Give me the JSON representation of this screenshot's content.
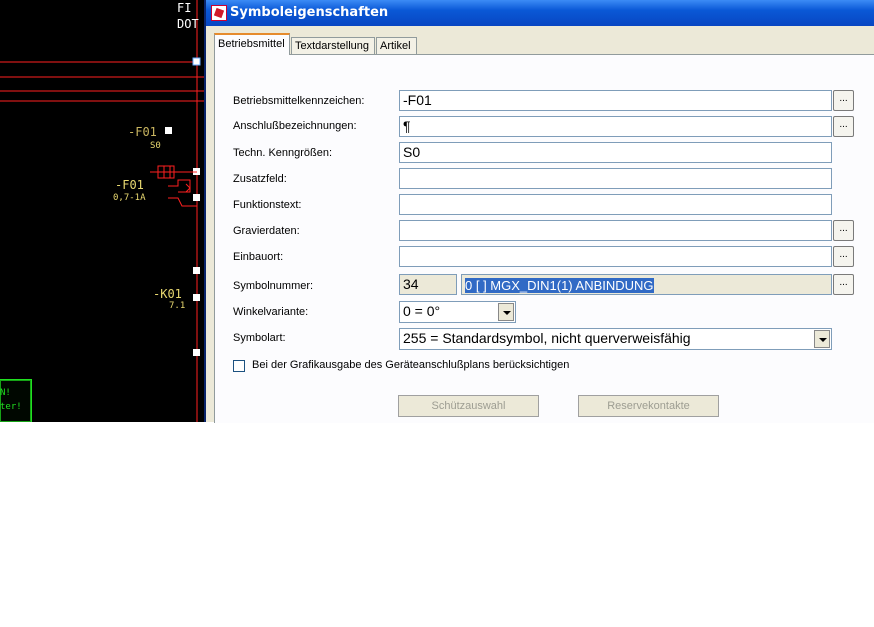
{
  "cad": {
    "top_label_1": "FI",
    "top_label_2": "DOT",
    "f01_top": "-F01",
    "f01_top_sub": "S0",
    "f01_mid": "-F01",
    "f01_mid_sub": "0,7-1A",
    "k01": "-K01",
    "k01_sub": "7.1",
    "green_text_1": "N!",
    "green_text_2": "ter!"
  },
  "dialog": {
    "title": "Symboleigenschaften",
    "tabs": [
      {
        "label": "Betriebsmittel"
      },
      {
        "label": "Textdarstellung"
      },
      {
        "label": "Artikel"
      }
    ],
    "fields": {
      "bmk_label": "Betriebsmittelkennzeichen:",
      "bmk_value": "-F01",
      "anschluss_label": "Anschlußbezeichnungen:",
      "anschluss_value": "¶",
      "kenngroessen_label": "Techn. Kenngrößen:",
      "kenngroessen_value": "S0",
      "zusatz_label": "Zusatzfeld:",
      "zusatz_value": "",
      "funktion_label": "Funktionstext:",
      "funktion_value": "",
      "gravier_label": "Gravierdaten:",
      "gravier_value": "",
      "einbau_label": "Einbauort:",
      "einbau_value": "",
      "symbolnr_label": "Symbolnummer:",
      "symbolnr_value": "34",
      "symbolnr_name": "0 [   ] MGX_DIN1(1) ANBINDUNG",
      "winkel_label": "Winkelvariante:",
      "winkel_value": "0 = 0°",
      "symbolart_label": "Symbolart:",
      "symbolart_value": "255 = Standardsymbol, nicht querverweisfähig"
    },
    "dots_label": "...",
    "checkbox_label": "Bei der Grafikausgabe des Geräteanschlußplans berücksichtigen",
    "buttons": {
      "schuetz": "Schützauswahl",
      "reserve": "Reservekontakte"
    }
  },
  "colors": {
    "cad_background": "#000000",
    "cad_red": "#ff2020",
    "cad_yellow": "#e8d870",
    "cad_green": "#20e020",
    "titlebar": "#0a58d6",
    "selection": "#316ac5"
  }
}
